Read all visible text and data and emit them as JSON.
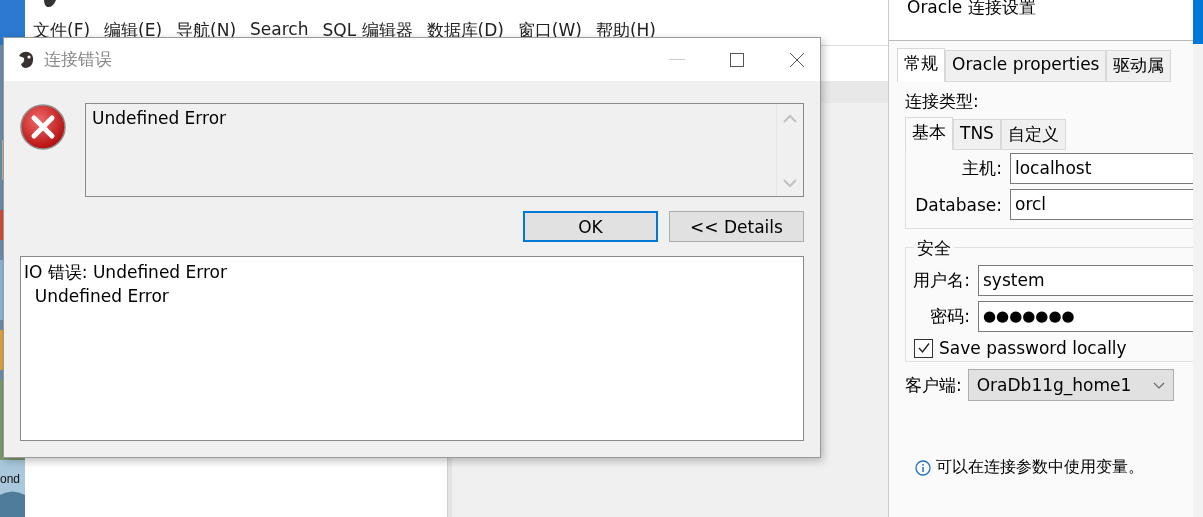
{
  "desktop": {
    "icon_label": "ond"
  },
  "ide": {
    "menu": [
      "文件(F)",
      "编辑(E)",
      "导航(N)",
      "Search",
      "SQL 编辑器",
      "数据库(D)",
      "窗口(W)",
      "帮助(H)"
    ]
  },
  "error_dialog": {
    "title": "连接错误",
    "message": "Undefined Error",
    "buttons": [
      {
        "label": "OK",
        "focused": true
      },
      {
        "label": "<< Details",
        "focused": false
      }
    ],
    "details": [
      "IO 错误: Undefined Error",
      "  Undefined Error"
    ]
  },
  "settings": {
    "title": "Oracle 连接设置",
    "tabs": [
      {
        "label": "常规",
        "selected": true
      },
      {
        "label": "Oracle properties",
        "selected": false
      },
      {
        "label": "驱动属",
        "selected": false
      }
    ],
    "connection_type_label": "连接类型:",
    "type_tabs": [
      {
        "label": "基本",
        "selected": true
      },
      {
        "label": "TNS",
        "selected": false
      },
      {
        "label": "自定义",
        "selected": false
      }
    ],
    "fields": [
      {
        "label": "主机:",
        "value": "localhost"
      },
      {
        "label": "Database:",
        "value": "orcl"
      }
    ],
    "security": {
      "title": "安全",
      "fields": [
        {
          "label": "用户名:",
          "value": "system",
          "kind": "text"
        },
        {
          "label": "密码:",
          "value": "●●●●●●●",
          "kind": "password"
        }
      ],
      "save_password": {
        "label": "Save password locally",
        "checked": true
      }
    },
    "client": {
      "label": "客户端:",
      "value": "OraDb11g_home1"
    },
    "hint": "可以在连接参数中使用变量。"
  }
}
